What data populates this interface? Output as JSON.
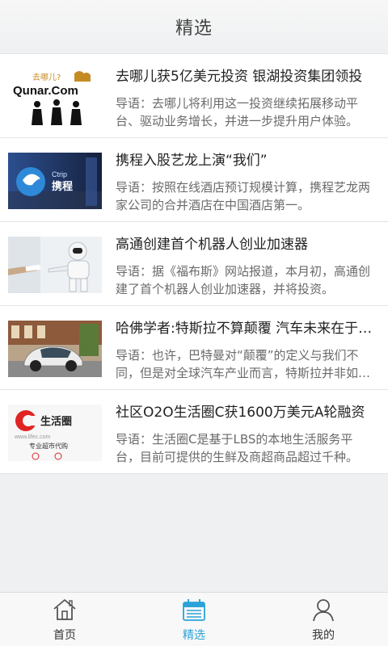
{
  "header": {
    "title": "精选"
  },
  "articles": [
    {
      "title": "去哪儿获5亿美元投资 银湖投资集团领投",
      "summary": "导语：去哪儿将利用这一投资继续拓展移动平台、驱动业务增长，并进一步提升用户体验。",
      "thumb_text": "Qunar.Com",
      "thumb_text2": "去哪儿?"
    },
    {
      "title": "携程入股艺龙上演“我们”",
      "summary": "导语：按照在线酒店预订规模计算，携程艺龙两家公司的合并酒店在中国酒店第一。",
      "thumb_text": "Ctrip",
      "thumb_text2": "携程"
    },
    {
      "title": "高通创建首个机器人创业加速器",
      "summary": "导语：据《福布斯》网站报道，本月初，高通创建了首个机器人创业加速器，并将投资。"
    },
    {
      "title": "哈佛学者:特斯拉不算颠覆 汽车未来在于共享",
      "summary": "导语：也许，巴特曼对“颠覆”的定义与我们不同，但是对全球汽车产业而言，特斯拉并非如此。"
    },
    {
      "title": "社区O2O生活圈C获1600万美元A轮融资",
      "summary": "导语：生活圈C是基于LBS的本地生活服务平台，目前可提供的生鲜及商超商品超过千种。",
      "thumb_text": "生活圈",
      "thumb_text2": "专业超市代购",
      "thumb_text3": "www.lifec.com"
    }
  ],
  "tabbar": {
    "tabs": [
      {
        "label": "首页",
        "icon": "home-icon"
      },
      {
        "label": "精选",
        "icon": "calendar-icon",
        "active": true
      },
      {
        "label": "我的",
        "icon": "user-icon"
      }
    ]
  },
  "colors": {
    "accent": "#2aa3d8",
    "background": "#eef0f2"
  }
}
